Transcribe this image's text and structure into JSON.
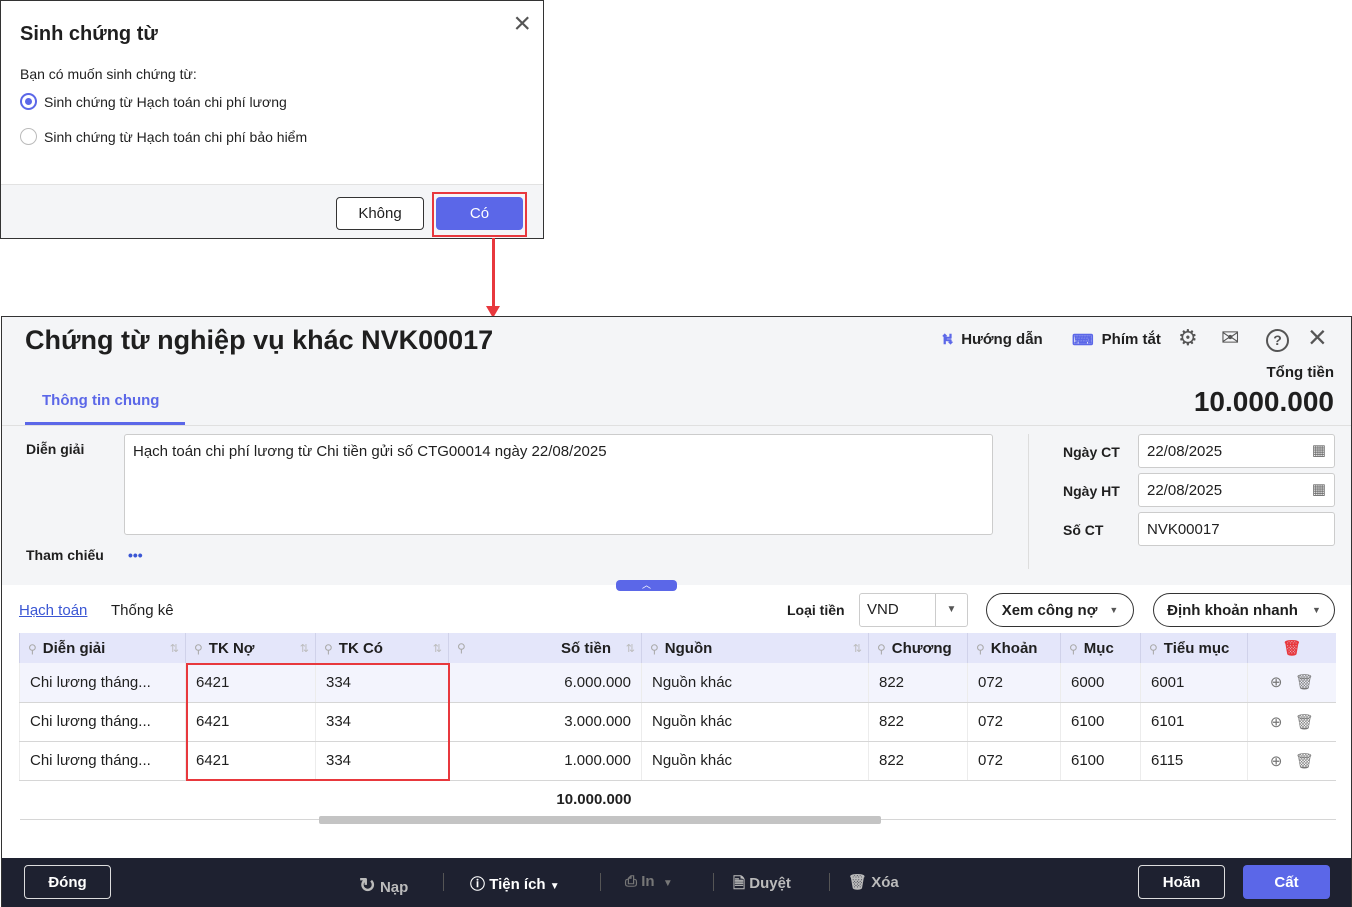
{
  "dialog": {
    "title": "Sinh chứng từ",
    "question": "Bạn có muốn sinh chứng từ:",
    "options": [
      {
        "label": "Sinh chứng từ Hạch toán chi phí lương",
        "selected": true
      },
      {
        "label": "Sinh chứng từ Hạch toán chi phí bảo hiểm",
        "selected": false
      }
    ],
    "no_label": "Không",
    "yes_label": "Có"
  },
  "header": {
    "title": "Chứng từ nghiệp vụ khác NVK00017",
    "guide": "Hướng dẫn",
    "shortcuts": "Phím tắt",
    "total_label": "Tổng tiền",
    "total_value": "10.000.000",
    "tab": "Thông tin chung"
  },
  "form": {
    "dien_giai_label": "Diễn giải",
    "dien_giai": "Hạch toán chi phí lương từ Chi tiền gửi số CTG00014 ngày 22/08/2025",
    "tham_chieu_label": "Tham chiếu",
    "tham_chieu_more": "•••",
    "ngay_ct_label": "Ngày CT",
    "ngay_ct": "22/08/2025",
    "ngay_ht_label": "Ngày HT",
    "ngay_ht": "22/08/2025",
    "so_ct_label": "Số CT",
    "so_ct": "NVK00017"
  },
  "grid_toolbar": {
    "tabs": [
      "Hạch toán",
      "Thống kê"
    ],
    "currency_label": "Loại tiền",
    "currency": "VND",
    "debt_btn": "Xem công nợ",
    "quick_btn": "Định khoản nhanh"
  },
  "table": {
    "columns": [
      "Diễn giải",
      "TK Nợ",
      "TK Có",
      "Số tiền",
      "Nguồn",
      "Chương",
      "Khoản",
      "Mục",
      "Tiểu mục"
    ],
    "rows": [
      [
        "Chi lương tháng...",
        "6421",
        "334",
        "6.000.000",
        "Nguồn khác",
        "822",
        "072",
        "6000",
        "6001"
      ],
      [
        "Chi lương tháng...",
        "6421",
        "334",
        "3.000.000",
        "Nguồn khác",
        "822",
        "072",
        "6100",
        "6101"
      ],
      [
        "Chi lương tháng...",
        "6421",
        "334",
        "1.000.000",
        "Nguồn khác",
        "822",
        "072",
        "6100",
        "6115"
      ]
    ],
    "total": "10.000.000"
  },
  "footer": {
    "close": "Đóng",
    "reload": "Nạp",
    "utilities": "Tiện ích",
    "print": "In",
    "approve": "Duyệt",
    "delete": "Xóa",
    "cancel": "Hoãn",
    "save": "Cất"
  },
  "colors": {
    "accent": "#5b67e8",
    "highlight": "#e8383d",
    "footer_bg": "#1e2130"
  }
}
